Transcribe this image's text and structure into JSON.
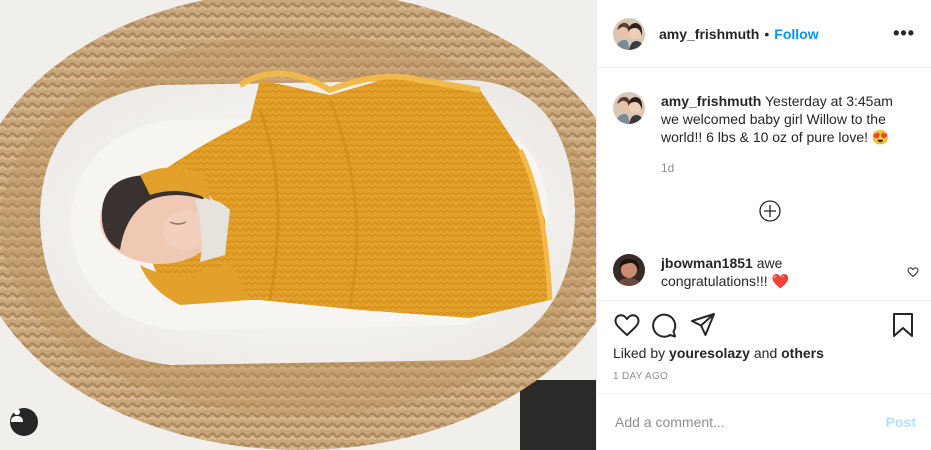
{
  "post": {
    "author": "amy_frishmuth",
    "follow_label": "Follow",
    "dot": "•",
    "more_icon": "more-horizontal-icon",
    "more_glyph": "•••"
  },
  "caption": {
    "username": "amy_frishmuth",
    "text": "Yesterday at 3:45am we welcomed baby girl Willow to the world!! 6 lbs & 10 oz of pure love! 😍",
    "time": "1d"
  },
  "comment": {
    "username": "jbowman1851",
    "text": "awe congratulations!!! ❤️"
  },
  "actions": {
    "like_icon": "heart-icon",
    "comment_icon": "comment-icon",
    "share_icon": "share-icon",
    "save_icon": "bookmark-icon"
  },
  "likes": {
    "prefix": "Liked by",
    "user": "youresolazy",
    "and": "and",
    "others": "others"
  },
  "age": "1 DAY AGO",
  "add_comment": {
    "placeholder": "Add a comment...",
    "post_label": "Post"
  },
  "colors": {
    "accent": "#0095f6",
    "post_disabled": "#b2dffc",
    "blanket": "#e5a22b",
    "heart_red": "#ed4956"
  }
}
